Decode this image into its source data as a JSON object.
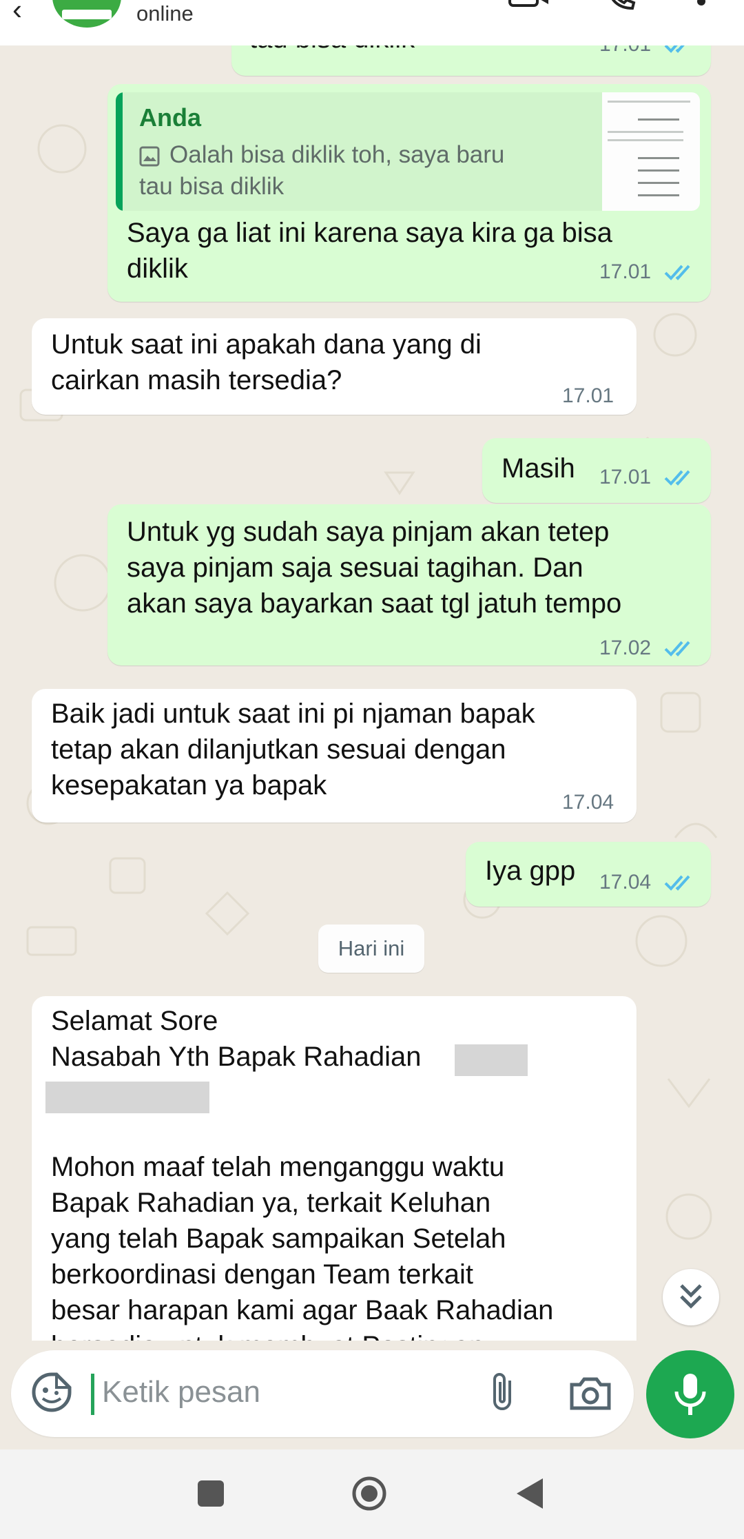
{
  "header": {
    "status": "online"
  },
  "messages": {
    "m0": {
      "text": "tau bisa diklik",
      "time": "17.01"
    },
    "m1": {
      "quote_author": "Anda",
      "quote_text": "Oalah bisa diklik toh, saya baru tau bisa diklik",
      "text": "Saya ga liat ini karena saya kira ga bisa\ndiklik",
      "time": "17.01"
    },
    "m2": {
      "text": "Untuk saat ini apakah dana yang di\ncairkan masih tersedia?",
      "time": "17.01"
    },
    "m3": {
      "text": "Masih",
      "time": "17.01"
    },
    "m4": {
      "text": "Untuk yg sudah saya pinjam akan tetep\nsaya pinjam saja sesuai tagihan. Dan\nakan saya bayarkan saat tgl jatuh tempo",
      "time": "17.02"
    },
    "m5": {
      "text": "Baik jadi untuk saat ini pi njaman bapak\ntetap akan dilanjutkan sesuai dengan\nkesepakatan ya bapak",
      "time": "17.04"
    },
    "m6": {
      "text": "Iya gpp",
      "time": "17.04"
    },
    "date_chip": "Hari ini",
    "m7": {
      "line1": "Selamat Sore",
      "line2": "Nasabah Yth Bapak Rahadian",
      "body": "Mohon maaf telah menganggu waktu\nBapak Rahadian ya, terkait Keluhan\nyang telah Bapak sampaikan Setelah\nberkoordinasi dengan Team terkait\nbesar harapan kami agar Baak Rahadian\nbersedia untuk membuat Postingan"
    }
  },
  "composer": {
    "placeholder": "Ketik pesan"
  },
  "colors": {
    "outgoing_bubble": "#d9fdd3",
    "incoming_bubble": "#ffffff",
    "read_ticks": "#53bdeb",
    "accent_green": "#1da851",
    "chat_background": "#efeae2"
  },
  "icons": [
    "back-arrow-icon",
    "video-call-icon",
    "voice-call-icon",
    "more-options-icon",
    "read-receipt-icon",
    "image-icon",
    "scroll-down-icon",
    "emoji-sticker-icon",
    "attach-icon",
    "camera-icon",
    "mic-icon",
    "nav-recents-icon",
    "nav-home-icon",
    "nav-back-icon"
  ]
}
